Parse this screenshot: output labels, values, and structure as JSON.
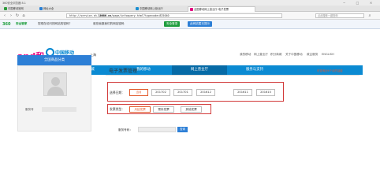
{
  "browser": {
    "title": "360安全浏览器 8.1",
    "window_controls": [
      "−",
      "□",
      "×"
    ],
    "tabs": [
      {
        "label": "中国移动官网",
        "color": "#2e9b3b",
        "active": false
      },
      {
        "label": "网址大全",
        "color": "#2a7fd4",
        "active": false
      },
      {
        "label": "中国移动网上营业厅",
        "color": "#1a8fd1",
        "active": false
      },
      {
        "label": "全国移动网上营业厅-电子发票",
        "color": "#e3007f",
        "active": true
      }
    ],
    "address": {
      "prefix": "http://service.sh.",
      "domain": "10086.cn",
      "suffix": "/page/infoquery.html?typecode=825040"
    },
    "search_placeholder": "点此搜索一键查询"
  },
  "bookmarks": {
    "logo": "360",
    "brand": "安全管家",
    "warning": "您现在访问的网站的密码？",
    "extra": "谁在偷窥我们的网站密码",
    "green_button": "安全登录",
    "blue_button": "此网站暂无提示"
  },
  "site": {
    "logo_andhe": "and和",
    "logo_cn": "中国移动",
    "logo_en": "China Mobile",
    "region": "上海",
    "top_links": [
      "我的移动",
      "网上营业厅",
      "积分商城",
      "关于中国移动",
      "政企服务",
      "ENGLISH"
    ],
    "nav": [
      "首页",
      "移动商城",
      "我的移动",
      "网上营业厅",
      "服务与支持"
    ],
    "active_nav": 3,
    "breadcrumb": "您现在的位置：首页 > 办业务 > 电子发票"
  },
  "sidebar": {
    "header": "全国商品分类",
    "service_label": "服务号"
  },
  "content": {
    "title": "电子发票管理",
    "link": "可查询近6个月的话费",
    "date_label": "选择日期：",
    "months": [
      "当月",
      "201702",
      "201701",
      "201612",
      "201611",
      "201610"
    ],
    "selected_month": 0,
    "type_label": "发票类型：",
    "invoice_types": [
      "月结发票",
      "预存发票",
      "其他发票"
    ],
    "selected_type": 0,
    "service_label": "服务号码：",
    "query_button": "查询"
  }
}
